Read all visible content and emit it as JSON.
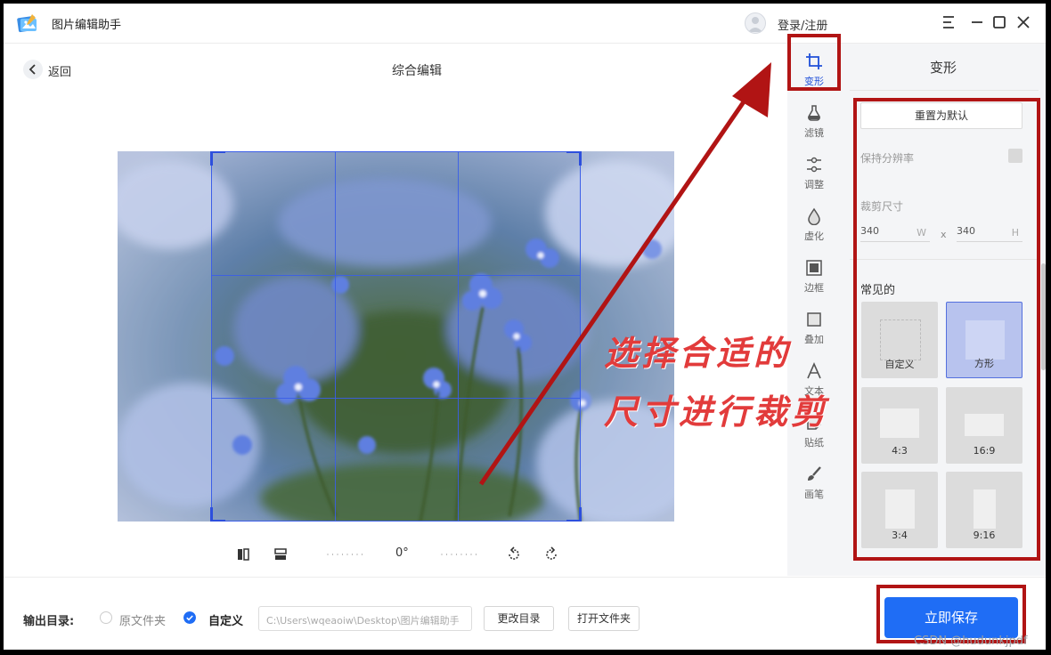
{
  "app": {
    "title": "图片编辑助手",
    "login": "登录/注册"
  },
  "header": {
    "back": "返回",
    "page_title": "综合编辑"
  },
  "rotation": {
    "degree": "0°"
  },
  "toolbar": {
    "items": [
      {
        "label": "变形",
        "icon": "crop-icon",
        "active": true
      },
      {
        "label": "滤镜",
        "icon": "filter-flask-icon"
      },
      {
        "label": "调整",
        "icon": "adjust-sliders-icon"
      },
      {
        "label": "虚化",
        "icon": "blur-drop-icon"
      },
      {
        "label": "边框",
        "icon": "frame-icon"
      },
      {
        "label": "叠加",
        "icon": "overlay-icon"
      },
      {
        "label": "文本",
        "icon": "text-icon"
      },
      {
        "label": "贴纸",
        "icon": "sticker-icon"
      },
      {
        "label": "画笔",
        "icon": "brush-icon"
      }
    ]
  },
  "panel": {
    "title": "变形",
    "reset": "重置为默认",
    "keep_resolution": "保持分辨率",
    "crop_size_label": "裁剪尺寸",
    "width": "340",
    "width_unit": "W",
    "separator": "x",
    "height": "340",
    "height_unit": "H",
    "common_label": "常见的",
    "presets": [
      {
        "label": "自定义"
      },
      {
        "label": "方形",
        "selected": true
      },
      {
        "label": "4:3"
      },
      {
        "label": "16:9"
      },
      {
        "label": "3:4"
      },
      {
        "label": "9:16"
      }
    ]
  },
  "bottom": {
    "output_label": "输出目录:",
    "option_original": "原文件夹",
    "option_custom": "自定义",
    "path": "C:\\Users\\wqeaoiw\\Desktop\\图片编辑助手",
    "change_dir": "更改目录",
    "open_folder": "打开文件夹",
    "save": "立即保存"
  },
  "annotation": {
    "line1": "选择合适的",
    "line2": "尺寸进行裁剪"
  },
  "watermark": "CSDN @hudunkjpdf",
  "colors": {
    "accent": "#1f6df5",
    "annotation_red": "#b11414",
    "crop_grid": "#3b5ee8"
  }
}
